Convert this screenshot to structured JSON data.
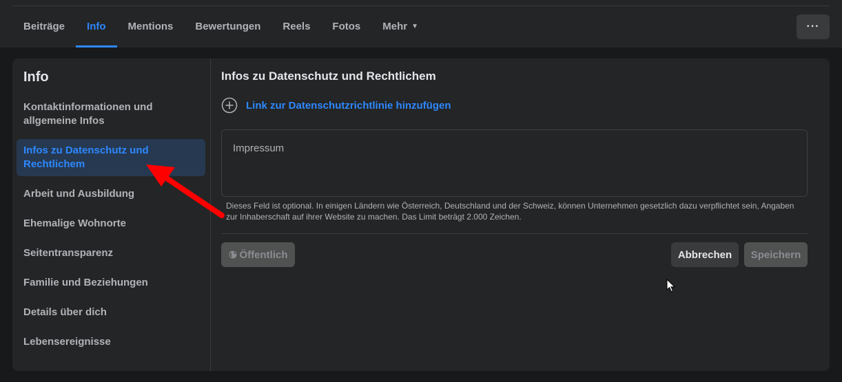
{
  "nav": {
    "tabs": [
      {
        "label": "Beiträge"
      },
      {
        "label": "Info"
      },
      {
        "label": "Mentions"
      },
      {
        "label": "Bewertungen"
      },
      {
        "label": "Reels"
      },
      {
        "label": "Fotos"
      },
      {
        "label": "Mehr"
      }
    ],
    "active_tab": "Info",
    "more_button": "···"
  },
  "sidebar": {
    "title": "Info",
    "items": [
      {
        "label": "Kontaktinformationen und allgemeine Infos"
      },
      {
        "label": "Infos zu Datenschutz und Rechtlichem"
      },
      {
        "label": "Arbeit und Ausbildung"
      },
      {
        "label": "Ehemalige Wohnorte"
      },
      {
        "label": "Seitentransparenz"
      },
      {
        "label": "Familie und Beziehungen"
      },
      {
        "label": "Details über dich"
      },
      {
        "label": "Lebensereignisse"
      }
    ],
    "active_item": "Infos zu Datenschutz und Rechtlichem"
  },
  "main": {
    "title": "Infos zu Datenschutz und Rechtlichem",
    "add_link_label": "Link zur Datenschutzrichtlinie hinzufügen",
    "textarea_placeholder": "Impressum",
    "textarea_value": "",
    "helper_text": "Dieses Feld ist optional. In einigen Ländern wie Österreich, Deutschland und der Schweiz, können Unternehmen gesetzlich dazu verpflichtet sein, Angaben zur Inhaberschaft auf ihrer Website zu machen. Das Limit beträgt 2.000 Zeichen.",
    "audience_button": "Öffentlich",
    "cancel_button": "Abbrechen",
    "save_button": "Speichern"
  },
  "icons": {
    "plus": "plus-circle-icon",
    "globe": "globe-icon",
    "caret": "caret-down-icon",
    "annotation": "red-arrow-icon",
    "cursor": "mouse-cursor-icon"
  },
  "colors": {
    "accent": "#2d88ff",
    "active_bg": "#263951",
    "annotation_arrow": "#ff0000"
  }
}
